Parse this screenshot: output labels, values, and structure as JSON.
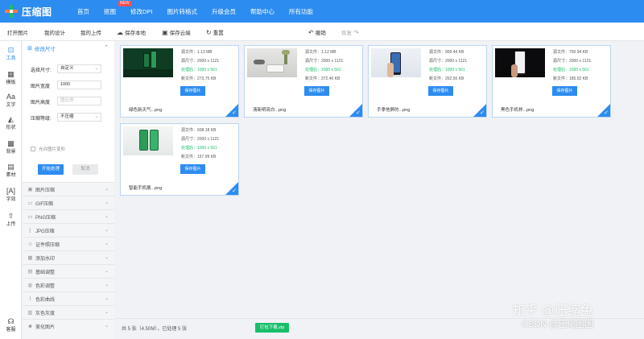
{
  "header": {
    "logo_text": "压缩图",
    "nav": [
      {
        "label": "首页"
      },
      {
        "label": "抠图",
        "badge": "NEW"
      },
      {
        "label": "修改DPI"
      },
      {
        "label": "图片转格式"
      },
      {
        "label": "升级会员"
      },
      {
        "label": "帮助中心"
      },
      {
        "label": "所有功能"
      }
    ]
  },
  "toolbar": {
    "open_image": "打开图片",
    "my_design": "我的设计",
    "my_upload": "我的上传",
    "save_local": "保存本地",
    "save_cloud": "保存云端",
    "reset": "重置",
    "undo": "撤销",
    "redo": "恢复"
  },
  "rail": {
    "items": [
      {
        "label": "工具",
        "icon": "toolbox-icon"
      },
      {
        "label": "模板",
        "icon": "template-icon"
      },
      {
        "label": "文字",
        "icon": "text-icon"
      },
      {
        "label": "形状",
        "icon": "shape-icon"
      },
      {
        "label": "背景",
        "icon": "background-icon"
      },
      {
        "label": "素材",
        "icon": "material-icon"
      },
      {
        "label": "字效",
        "icon": "text-effect-icon"
      },
      {
        "label": "上传",
        "icon": "upload-icon"
      },
      {
        "label": "客服",
        "icon": "headset-icon"
      }
    ]
  },
  "panel": {
    "title": "修改尺寸",
    "size_label": "选择尺寸:",
    "size_value": "自定义",
    "width_label": "图片宽度",
    "width_value": "1000",
    "height_label": "图片高度",
    "height_placeholder": "图比例",
    "level_label": "压缩等级:",
    "level_value": "不压缩",
    "allow_deform": "允许图片变形",
    "start_button": "开始处理",
    "cancel_button": "取消",
    "sections": [
      {
        "label": "图片压缩",
        "icon": "compress-icon"
      },
      {
        "label": "GIF压缩",
        "icon": "gif-icon"
      },
      {
        "label": "PNG压缩",
        "icon": "png-icon"
      },
      {
        "label": "JPG压缩",
        "icon": "jpg-icon"
      },
      {
        "label": "证件照压缩",
        "icon": "id-photo-icon"
      },
      {
        "label": "添加水印",
        "icon": "watermark-icon"
      },
      {
        "label": "基础调整",
        "icon": "adjust-icon"
      },
      {
        "label": "色彩调整",
        "icon": "color-icon"
      },
      {
        "label": "色彩曲线",
        "icon": "curve-icon"
      },
      {
        "label": "灰色灰度",
        "icon": "grayscale-icon"
      },
      {
        "label": "美化图片",
        "icon": "beautify-icon"
      }
    ]
  },
  "cards": [
    {
      "src_size": "源文件：1.13 MB",
      "src_dim": "源尺寸：2000 x 1121",
      "proc": "处理后：1000 x 561",
      "new_size": "新文件：273.75 KB",
      "save": "保存图片",
      "name": "绿色新天气...png"
    },
    {
      "src_size": "源文件：1.12 MB",
      "src_dim": "源尺寸：2000 x 1121",
      "proc": "处理后：1000 x 561",
      "new_size": "新文件：372.40 KB",
      "save": "保存图片",
      "name": "清新明亮白...png"
    },
    {
      "src_size": "源文件：999.44 KB",
      "src_dim": "源尺寸：2000 x 1121",
      "proc": "处理后：1000 x 561",
      "new_size": "新文件：262.56 KB",
      "save": "保存图片",
      "name": "手拿他屏的...png"
    },
    {
      "src_size": "源文件：700.94 KB",
      "src_dim": "源尺寸：2000 x 1121",
      "proc": "处理后：1000 x 561",
      "new_size": "新文件：185.52 KB",
      "save": "保存图片",
      "name": "黑色手机样...png"
    },
    {
      "src_size": "源文件：608.18 KB",
      "src_dim": "源尺寸：2000 x 1121",
      "proc": "处理后：1000 x 561",
      "new_size": "新文件：157.99 KB",
      "save": "保存图片",
      "name": "智能手机展...png"
    }
  ],
  "footer": {
    "summary": "共 5 张（4.50M），已处理 5 张",
    "zip_button": "打包下载.zip"
  },
  "watermark": {
    "line1": "知乎 @压缩兔",
    "line2": "CSDN @压缩图图"
  },
  "colors": {
    "brand": "#2d8cf0",
    "success": "#19be6b"
  }
}
